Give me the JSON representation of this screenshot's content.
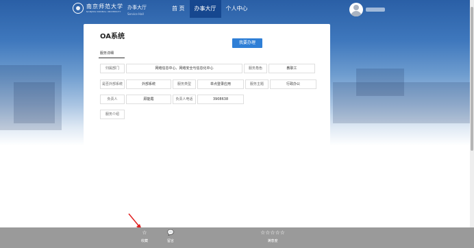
{
  "header": {
    "logo_name": "南京师范大学",
    "logo_en": "NANJING NORMAL UNIVERSITY",
    "brand_cn": "办事大厅",
    "brand_en": "Service Hall",
    "nav": [
      {
        "label": "首 页",
        "active": false
      },
      {
        "label": "办事大厅",
        "active": true
      },
      {
        "label": "个人中心",
        "active": false
      }
    ]
  },
  "service": {
    "title": "OA系统",
    "apply_label": "我要办理",
    "tab_label": "服务详细",
    "rows": [
      [
        {
          "label": "归属部门",
          "value": "网络信息中心、网络安全与信息化中心"
        },
        {
          "label": "服务角色",
          "value": "教职工"
        }
      ],
      [
        {
          "label": "是否外部系统",
          "value": "外部系统"
        },
        {
          "label": "服务类型",
          "value": "单点登录应用"
        },
        {
          "label": "服务主题",
          "value": "行政办公"
        }
      ],
      [
        {
          "label": "负责人",
          "value": "顾能霞"
        },
        {
          "label": "负责人电话",
          "value": "3908638"
        }
      ],
      [
        {
          "label": "服务介绍"
        }
      ]
    ]
  },
  "bottom_bar": {
    "favorite": {
      "icon": "star-outline-icon",
      "label": "收藏"
    },
    "comment": {
      "icon": "comment-bubble-icon",
      "label": "留言"
    },
    "rating": {
      "icon": "five-star-rating-icon",
      "stars": 5,
      "label": "满意度"
    }
  },
  "colors": {
    "header_blue": "#2a5fa6",
    "nav_active": "#16478f",
    "button_blue": "#2f7fd6",
    "bottom_bar": "#9a9a9a",
    "arrow": "#e02020"
  }
}
